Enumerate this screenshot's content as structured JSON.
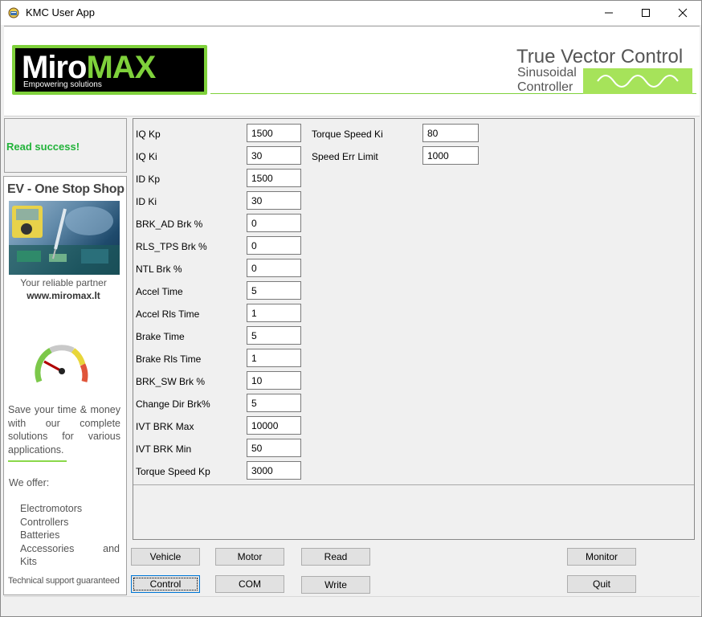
{
  "window": {
    "title": "KMC User App",
    "controls": [
      "minimize",
      "maximize",
      "close"
    ]
  },
  "header": {
    "logo_word_1": "Miro",
    "logo_word_2": "MAX",
    "logo_tagline": "Empowering solutions",
    "product_title": "True Vector Control",
    "product_sub_1": "Sinusoidal",
    "product_sub_2": "Controller"
  },
  "status": {
    "text": "Read success!",
    "color": "#22b33a"
  },
  "ad": {
    "title": "EV - One Stop Shop",
    "partner": "Your reliable partner",
    "url": "www.miromax.lt",
    "save_text": "Save your time & money with our complete solutions for various applications.",
    "offer_title": "We offer:",
    "offer_items": [
      "Electromotors",
      "Controllers",
      "Batteries",
      "Accessories and",
      "Kits"
    ],
    "support": "Technical support guaranteed"
  },
  "params_left": [
    {
      "label": "IQ Kp",
      "value": "1500"
    },
    {
      "label": "IQ Ki",
      "value": "30"
    },
    {
      "label": "ID Kp",
      "value": "1500"
    },
    {
      "label": "ID Ki",
      "value": "30"
    },
    {
      "label": "BRK_AD Brk %",
      "value": "0"
    },
    {
      "label": "RLS_TPS Brk %",
      "value": "0"
    },
    {
      "label": "NTL Brk %",
      "value": "0"
    },
    {
      "label": "Accel Time",
      "value": "5"
    },
    {
      "label": "Accel Rls Time",
      "value": "1"
    },
    {
      "label": "Brake Time",
      "value": "5"
    },
    {
      "label": "Brake Rls Time",
      "value": "1"
    },
    {
      "label": "BRK_SW Brk %",
      "value": "10"
    },
    {
      "label": "Change Dir Brk%",
      "value": "5"
    },
    {
      "label": "IVT BRK Max",
      "value": "10000"
    },
    {
      "label": "IVT BRK Min",
      "value": "50"
    },
    {
      "label": "Torque Speed Kp",
      "value": "3000"
    }
  ],
  "params_right": [
    {
      "label": "Torque Speed Ki",
      "value": "80"
    },
    {
      "label": "Speed Err Limit",
      "value": "1000"
    }
  ],
  "buttons": {
    "vehicle": "Vehicle",
    "motor": "Motor",
    "read": "Read",
    "monitor": "Monitor",
    "control": "Control",
    "com": "COM",
    "write": "Write",
    "quit": "Quit"
  },
  "colors": {
    "brand_green": "#7fd13b",
    "status_green": "#22b33a"
  }
}
